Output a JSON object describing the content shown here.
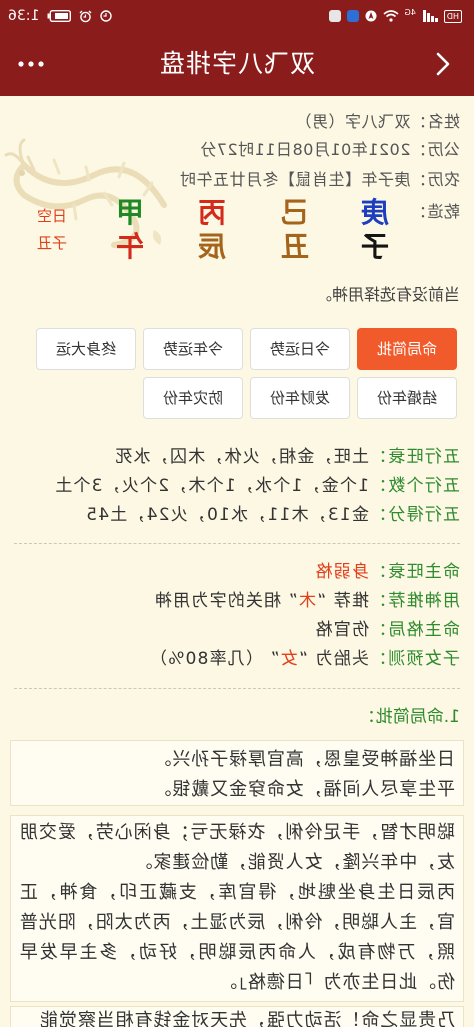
{
  "theme": {
    "header_bg": "#8b1c1c",
    "page_bg": "#fdf8e4",
    "active_button_bg": "#f15a2b",
    "label_green": "#2e8b2e",
    "highlight_red": "#e2401c"
  },
  "status_bar": {
    "hd": "HD",
    "network": "4G",
    "time": "1:36"
  },
  "header": {
    "title": "双飞八字排盘",
    "back_icon": "chevron-left-icon",
    "more_icon": "more-dots-icon"
  },
  "info": {
    "name": {
      "label": "姓名：",
      "value": "双飞八字（男）"
    },
    "solar": {
      "label": "公历：",
      "value": "2021年01月08日11时27分"
    },
    "lunar": {
      "label": "农历：",
      "value": "庚子年【生肖鼠】冬月廿五午时"
    },
    "pillars_label": "乾造：",
    "pillars": [
      {
        "stem": "庚",
        "stem_color": "#1d3fbf",
        "branch": "子",
        "branch_color": "#151515"
      },
      {
        "stem": "己",
        "stem_color": "#a5641c",
        "branch": "丑",
        "branch_color": "#a5641c"
      },
      {
        "stem": "丙",
        "stem_color": "#d42a1c",
        "branch": "辰",
        "branch_color": "#a5641c"
      },
      {
        "stem": "甲",
        "stem_color": "#1f8a24",
        "branch": "午",
        "branch_color": "#d42a1c"
      }
    ],
    "void": {
      "label": "日空",
      "value": "子丑"
    }
  },
  "notice": "当前没有选择用神。",
  "buttons": [
    {
      "label": "命局简批",
      "active": true
    },
    {
      "label": "今日运势",
      "active": false
    },
    {
      "label": "今年运势",
      "active": false
    },
    {
      "label": "终身大运",
      "active": false
    },
    {
      "label": "结婚年份",
      "active": false
    },
    {
      "label": "发财年份",
      "active": false
    },
    {
      "label": "防灾年份",
      "active": false
    }
  ],
  "wuxing": {
    "wangshuai": {
      "label": "五行旺衰：",
      "value": "土旺，金相，火休，木囚，水死"
    },
    "count": {
      "label": "五行个数：",
      "value": "1个金，1个水，1个木，2个火，3个土"
    },
    "score": {
      "label": "五行得分：",
      "value": "金13，木11，水10，火24，土45"
    }
  },
  "mingzhu": {
    "strength": {
      "label": "命主旺衰：",
      "value": "身弱格"
    },
    "yongshen": {
      "label": "用神推荐：",
      "prefix": "推荐 “",
      "highlight": "木",
      "suffix": "” 相关的字为用神"
    },
    "geju": {
      "label": "命主格局：",
      "value": "伤官格"
    },
    "children": {
      "label": "子女预测：",
      "prefix": "头胎为 “",
      "highlight": "女",
      "suffix": "” （几率80%）"
    }
  },
  "analysis": {
    "title": "1.命局简批：",
    "poem": [
      "日坐福神受皇恩，高官厚禄子孙兴。",
      "平生享尽人间福，女命穿金又戴银。"
    ],
    "paragraphs": [
      "聪明才智，手足伶俐，衣禄无亏；身闲心劳，爱交朋友，中年兴隆，女人贤能，勤俭建家。",
      "丙辰日生身坐魁地，得官库，支藏正印，食神，正官，主人聪明，伶俐，辰为湿土，丙为太阳，阳光普照，万物有成，人命丙辰聪明，好动，多主早发早伤。此日生亦为「日德格」。"
    ],
    "continued": "乃贵显之命！活动力强，先天对金钱有相当察觉能"
  }
}
